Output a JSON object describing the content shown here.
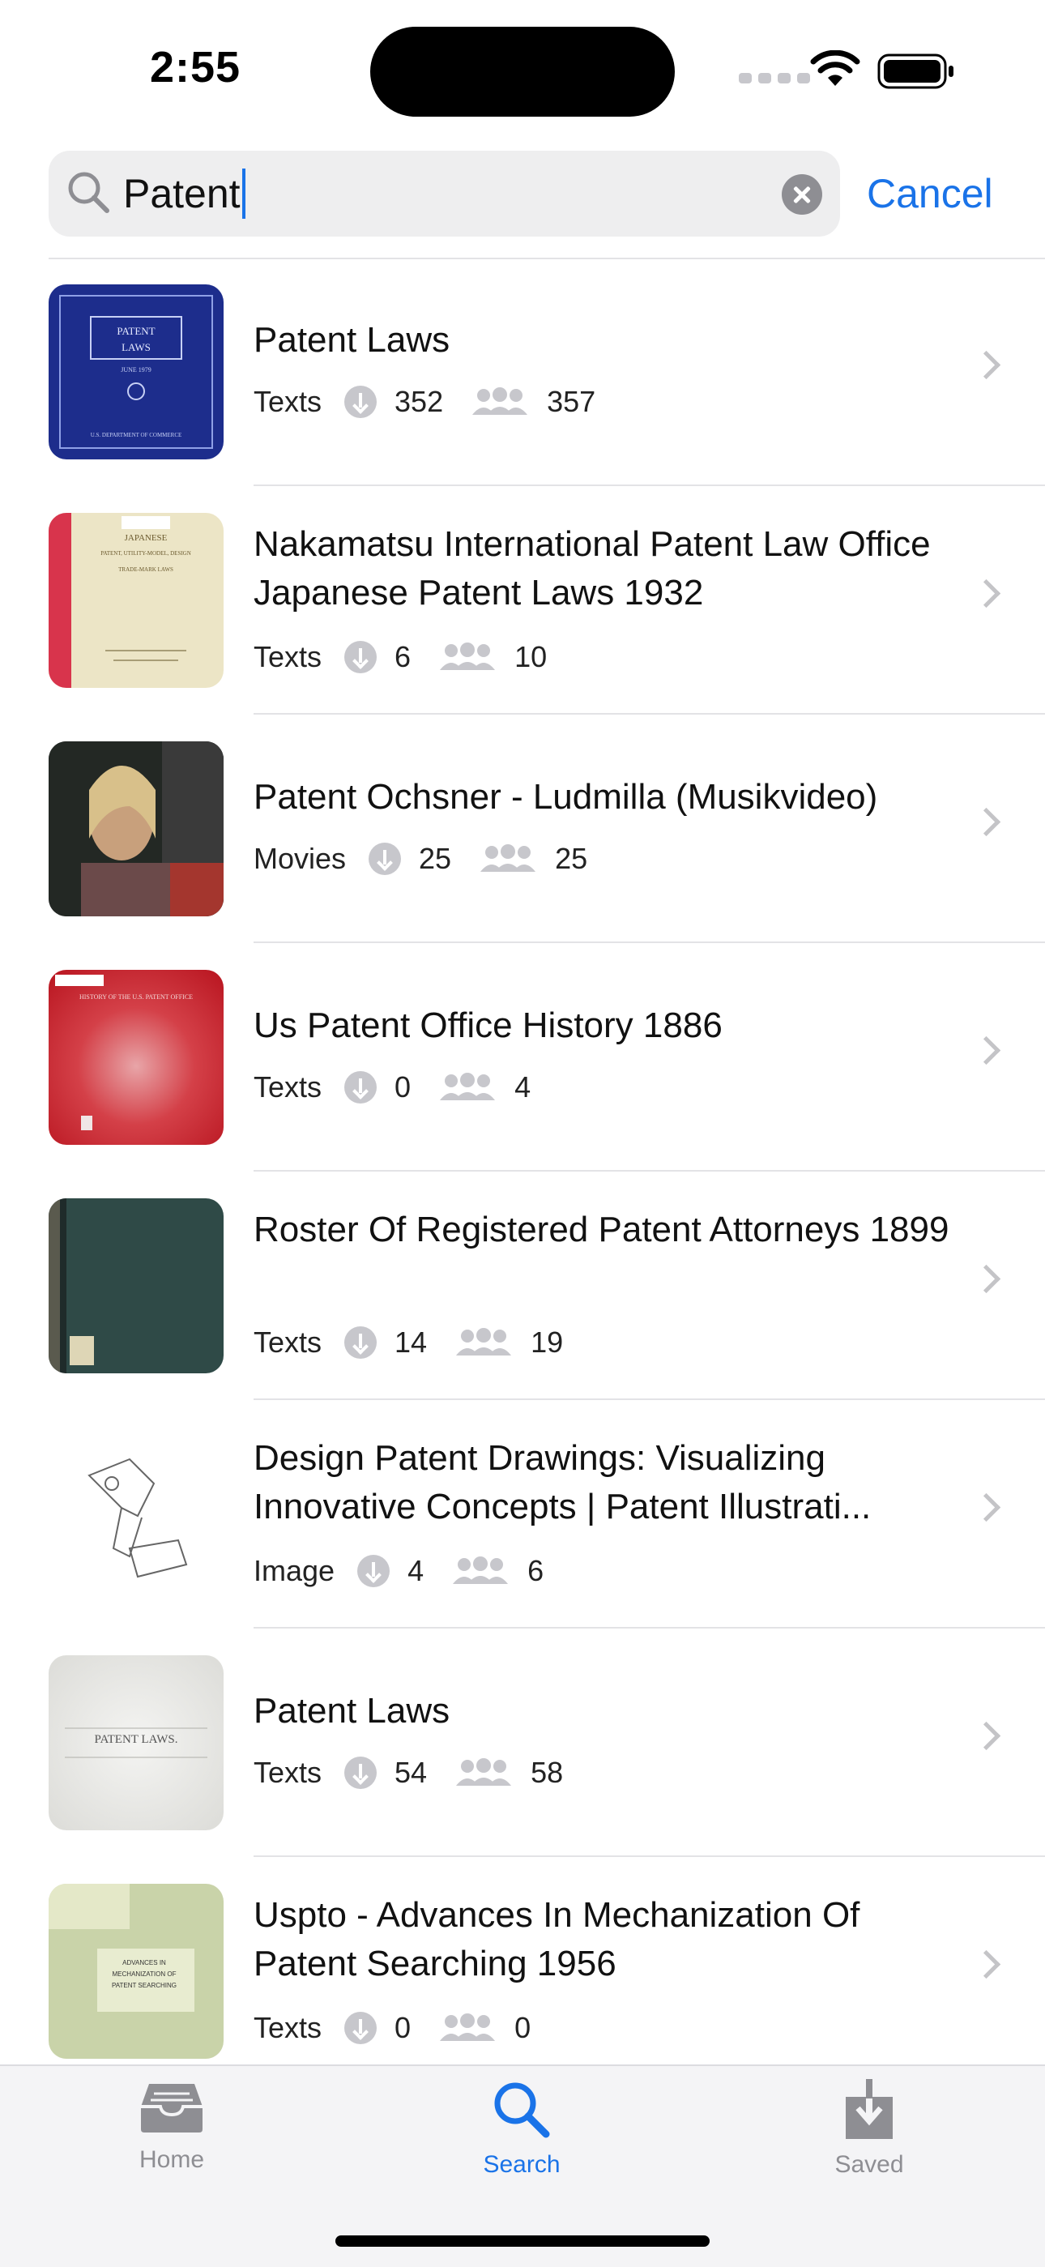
{
  "status": {
    "time": "2:55"
  },
  "search": {
    "query": "Patent",
    "cancel_label": "Cancel"
  },
  "results": [
    {
      "title": "Patent Laws",
      "type": "Texts",
      "downloads": "352",
      "views": "357"
    },
    {
      "title": "Nakamatsu International Patent Law Office Japanese Patent Laws 1932",
      "type": "Texts",
      "downloads": "6",
      "views": "10"
    },
    {
      "title": "Patent Ochsner - Ludmilla (Musikvideo)",
      "type": "Movies",
      "downloads": "25",
      "views": "25"
    },
    {
      "title": "Us Patent Office History 1886",
      "type": "Texts",
      "downloads": "0",
      "views": "4"
    },
    {
      "title": "Roster Of Registered Patent Attorneys 1899",
      "type": "Texts",
      "downloads": "14",
      "views": "19"
    },
    {
      "title": "Design Patent Drawings: Visualizing Innovative Concepts | Patent Illustrati...",
      "type": "Image",
      "downloads": "4",
      "views": "6"
    },
    {
      "title": "Patent Laws",
      "type": "Texts",
      "downloads": "54",
      "views": "58"
    },
    {
      "title": "Uspto - Advances In Mechanization Of Patent Searching 1956",
      "type": "Texts",
      "downloads": "0",
      "views": "0"
    }
  ],
  "thumb_text": {
    "r0": [
      "PATENT",
      "LAWS",
      "JUNE 1979",
      "U.S. DEPARTMENT OF COMMERCE"
    ],
    "r1": [
      "JAPANESE",
      "PATENT, UTILITY-MODEL, DESIGN",
      "TRADE-MARK LAWS"
    ],
    "r3": [
      "HISTORY OF THE U.S. PATENT OFFICE"
    ],
    "r6": [
      "PATENT LAWS."
    ],
    "r7": [
      "ADVANCES IN",
      "MECHANIZATION OF",
      "PATENT SEARCHING"
    ]
  },
  "tabs": {
    "home": "Home",
    "search": "Search",
    "saved": "Saved"
  },
  "colors": {
    "accent": "#1a73e8",
    "inactive": "#8e8e93"
  },
  "icons": [
    "search-icon",
    "clear-icon",
    "download-icon",
    "people-icon",
    "chevron-right-icon",
    "home-tray-icon",
    "saved-download-icon",
    "wifi-icon",
    "battery-icon"
  ]
}
